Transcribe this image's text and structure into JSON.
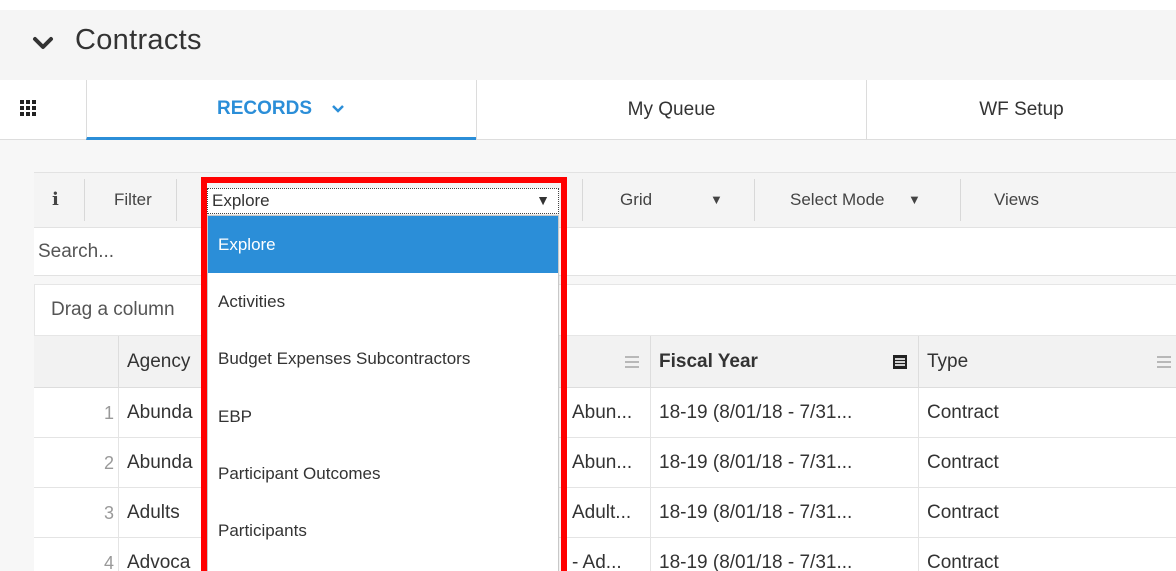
{
  "header": {
    "title": "Contracts"
  },
  "tabs": [
    {
      "label": "RECORDS",
      "active": true
    },
    {
      "label": "My Queue",
      "active": false
    },
    {
      "label": "WF Setup",
      "active": false
    }
  ],
  "toolbar": {
    "info": "i",
    "filter": "Filter",
    "explore_value": "Explore",
    "grid": "Grid",
    "select_mode": "Select Mode",
    "views": "Views"
  },
  "search": {
    "placeholder": "Search..."
  },
  "grouping": {
    "hint": "Drag a column"
  },
  "grid": {
    "columns": [
      "Agency",
      "Fiscal Year",
      "Type"
    ],
    "rows": [
      {
        "num": "1",
        "agency": "Abunda",
        "name": "Abun...",
        "fiscal_year": "18-19 (8/01/18 - 7/31...",
        "type": "Contract"
      },
      {
        "num": "2",
        "agency": "Abunda",
        "name": "Abun...",
        "fiscal_year": "18-19 (8/01/18 - 7/31...",
        "type": "Contract"
      },
      {
        "num": "3",
        "agency": "Adults",
        "name": "Adult...",
        "fiscal_year": "18-19 (8/01/18 - 7/31...",
        "type": "Contract"
      },
      {
        "num": "4",
        "agency": "Advoca",
        "name": "- Ad...",
        "fiscal_year": "18-19 (8/01/18 - 7/31...",
        "type": "Contract"
      }
    ]
  },
  "dropdown": {
    "options": [
      {
        "label": "Explore",
        "selected": true
      },
      {
        "label": "Activities",
        "selected": false
      },
      {
        "label": "Budget Expenses Subcontractors",
        "selected": false
      },
      {
        "label": "EBP",
        "selected": false
      },
      {
        "label": "Participant Outcomes",
        "selected": false
      },
      {
        "label": "Participants",
        "selected": false
      }
    ]
  },
  "colors": {
    "accent": "#2b8ed8",
    "highlight": "#ff0000",
    "header_bg": "#f5f5f5"
  },
  "icons": [
    "chevron-down-icon",
    "apps-grid-icon",
    "info-icon",
    "caret-down-icon",
    "column-menu-icon"
  ]
}
